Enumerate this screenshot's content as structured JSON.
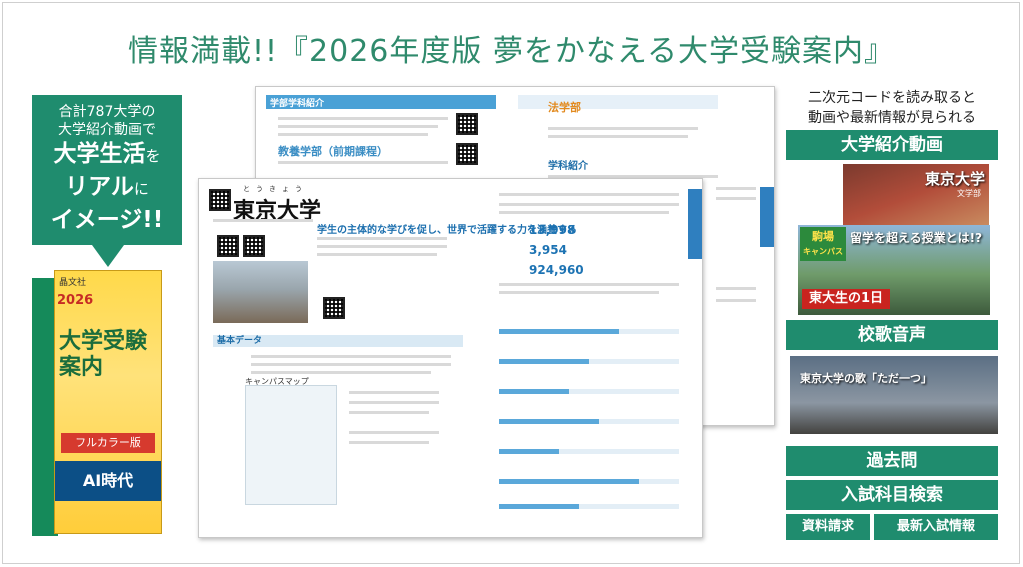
{
  "headline": "情報満載!!『2026年度版 夢をかなえる大学受験案内』",
  "promo": {
    "line1": "合計787大学の",
    "line2": "大学紹介動画で",
    "big1": "大学生活",
    "big1_suffix": "を",
    "big2": "リアル",
    "big2_suffix": "に",
    "big3": "イメージ!!"
  },
  "book": {
    "publisher": "晶文社",
    "year": "2026",
    "title": "大学受験案内",
    "tag": "フルカラー版",
    "band": "AI時代"
  },
  "back_page": {
    "section_title": "学部学科紹介",
    "subsection": "教養学部（前期課程）",
    "right_title": "法学部",
    "right_section": "学科紹介"
  },
  "front_page": {
    "ruby": "とうきょう",
    "university": "東京大学",
    "tagline": "学生の主体的な学びを促し、世界で活躍する力を涵養する",
    "section": "基本データ",
    "campus_map": "キャンパスマップ",
    "students": "13,998",
    "faculty": "3,954",
    "books": "924,960"
  },
  "right_panel": {
    "qr_note_line1": "二次元コードを読み取ると",
    "qr_note_line2": "動画や最新情報が見られる",
    "video_button": "大学紹介動画",
    "thumb1_title": "東京大学",
    "thumb1_sub": "文学部",
    "thumb2_chip_line1": "駒場",
    "thumb2_chip_line2": "キャンパス",
    "thumb2_caption": "留学を超える授業とは!?",
    "thumb2_badge": "東大生の1日",
    "song_button": "校歌音声",
    "song_text": "東京大学の歌「ただ一つ」",
    "past_button": "過去問",
    "exam_button": "入試科目検索",
    "doc_button": "資料請求",
    "latest_button": "最新入試情報"
  },
  "colors": {
    "brand_green": "#1f8c6e",
    "headline_green": "#2f8a6c",
    "page_blue": "#4aa1d6"
  }
}
